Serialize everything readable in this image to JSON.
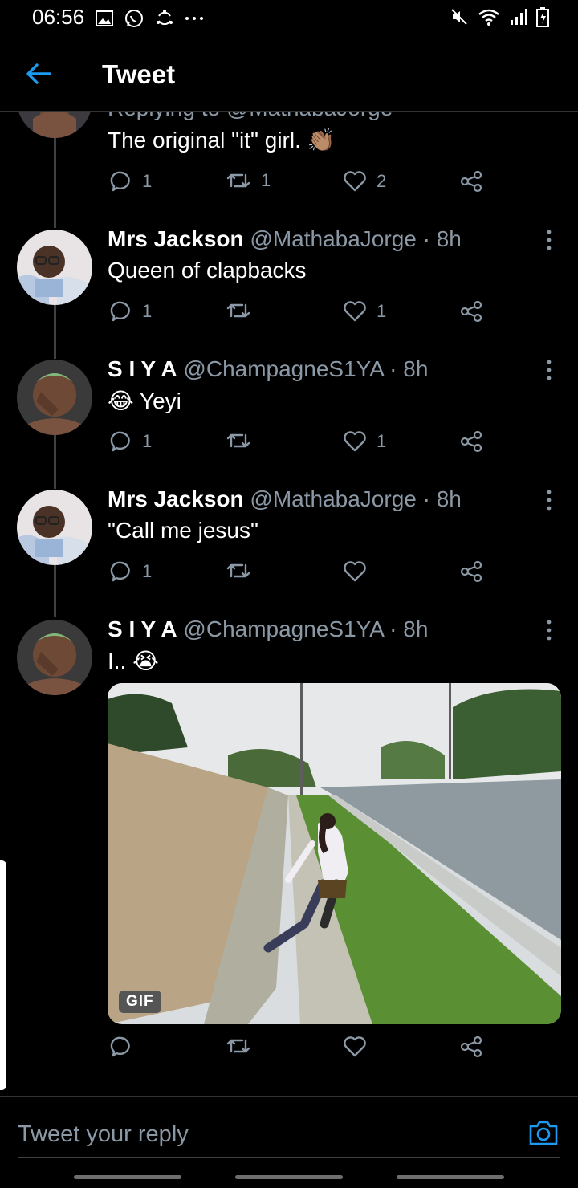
{
  "status_bar": {
    "time": "06:56",
    "left_icons": [
      "image-icon",
      "whatsapp-icon",
      "sync-icon",
      "more-dots-icon"
    ],
    "right_icons": [
      "mute-icon",
      "wifi-icon",
      "signal-icon",
      "battery-icon"
    ]
  },
  "header": {
    "title": "Tweet",
    "accent_color": "#1d9bf0"
  },
  "cutoff_reply_line": "Replying to @MathabaJorge",
  "tweets": [
    {
      "text": "The original \"it\" girl. 👏🏽",
      "actions": {
        "reply_count": "1",
        "retweet_count": "1",
        "like_count": "2"
      }
    },
    {
      "name": "Mrs Jackson",
      "handle": "@MathabaJorge · 8h",
      "text": "Queen of clapbacks",
      "actions": {
        "reply_count": "1",
        "retweet_count": "",
        "like_count": "1"
      }
    },
    {
      "name": "S I Y A",
      "handle": "@ChampagneS1YA · 8h",
      "text": "😂 Yeyi",
      "actions": {
        "reply_count": "1",
        "retweet_count": "",
        "like_count": "1"
      }
    },
    {
      "name": "Mrs Jackson",
      "handle": "@MathabaJorge · 8h",
      "text": "\"Call me jesus\"",
      "actions": {
        "reply_count": "1",
        "retweet_count": "",
        "like_count": ""
      }
    },
    {
      "name": "S I Y A",
      "handle": "@ChampagneS1YA · 8h",
      "text": "I.. 😭",
      "media_badge": "GIF",
      "actions": {
        "reply_count": "",
        "retweet_count": "",
        "like_count": ""
      }
    }
  ],
  "reply_bar": {
    "placeholder": "Tweet your reply"
  }
}
